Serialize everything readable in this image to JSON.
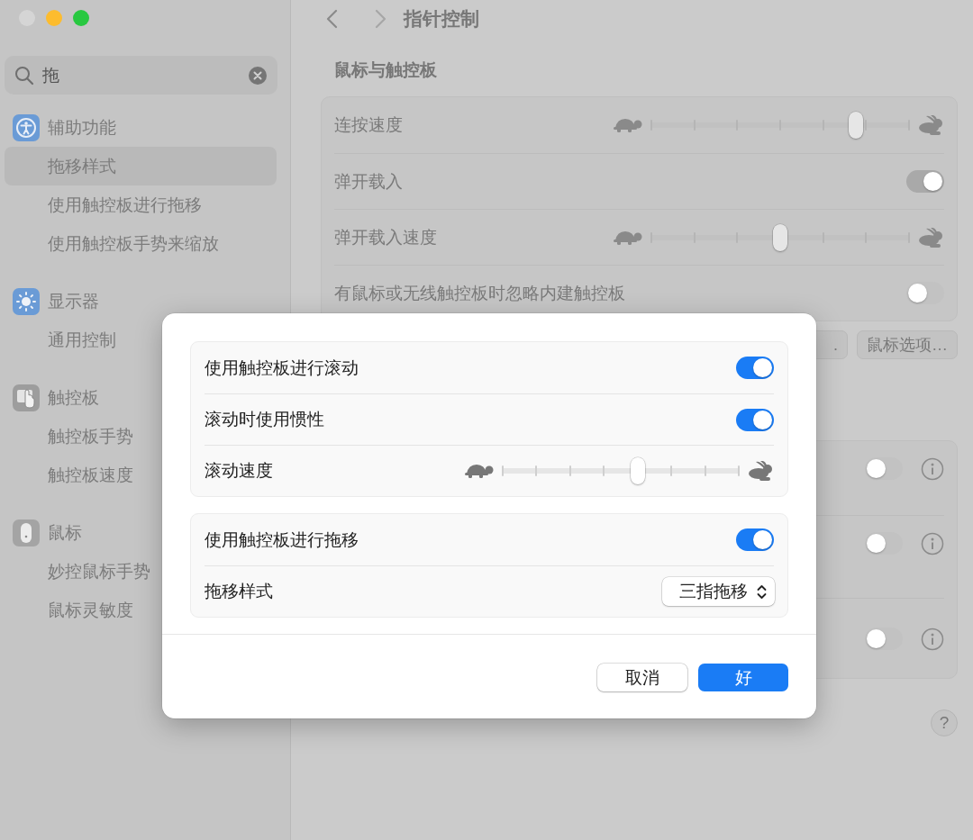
{
  "window": {
    "title": "指针控制"
  },
  "sidebar": {
    "search": {
      "value": "拖"
    },
    "sections": [
      {
        "label": "辅助功能",
        "children": [
          {
            "label": "拖移样式",
            "selected": true
          },
          {
            "label": "使用触控板进行拖移",
            "selected": false
          },
          {
            "label": "使用触控板手势来缩放",
            "selected": false
          }
        ]
      },
      {
        "label": "显示器",
        "children": [
          {
            "label": "通用控制",
            "selected": false
          }
        ]
      },
      {
        "label": "触控板",
        "children": [
          {
            "label": "触控板手势",
            "selected": false
          },
          {
            "label": "触控板速度",
            "selected": false
          }
        ]
      },
      {
        "label": "鼠标",
        "children": [
          {
            "label": "妙控鼠标手势",
            "selected": false
          },
          {
            "label": "鼠标灵敏度",
            "selected": false
          }
        ]
      }
    ]
  },
  "main": {
    "section_title": "鼠标与触控板",
    "settings": [
      {
        "kind": "slider",
        "label": "连按速度",
        "level": 0.79
      },
      {
        "kind": "toggle",
        "label": "弹开载入",
        "on": true
      },
      {
        "kind": "slider",
        "label": "弹开载入速度",
        "level": 0.5
      },
      {
        "kind": "toggle",
        "label": "有鼠标或无线触控板时忽略内建触控板",
        "on": false
      }
    ],
    "buttons": [
      ".",
      "鼠标选项…"
    ],
    "lower_rows": [
      {
        "on": false
      },
      {
        "on": false
      },
      {
        "on": false
      }
    ],
    "help": "?"
  },
  "dialog": {
    "groups": [
      [
        {
          "kind": "toggle",
          "label": "使用触控板进行滚动",
          "on": true
        },
        {
          "kind": "toggle",
          "label": "滚动时使用惯性",
          "on": true
        },
        {
          "kind": "slider",
          "label": "滚动速度",
          "level": 0.571
        }
      ],
      [
        {
          "kind": "toggle",
          "label": "使用触控板进行拖移",
          "on": true
        },
        {
          "kind": "popup",
          "label": "拖移样式",
          "value": "三指拖移"
        }
      ]
    ],
    "buttons": [
      {
        "label": "取消",
        "default": false
      },
      {
        "label": "好",
        "default": true
      }
    ]
  }
}
